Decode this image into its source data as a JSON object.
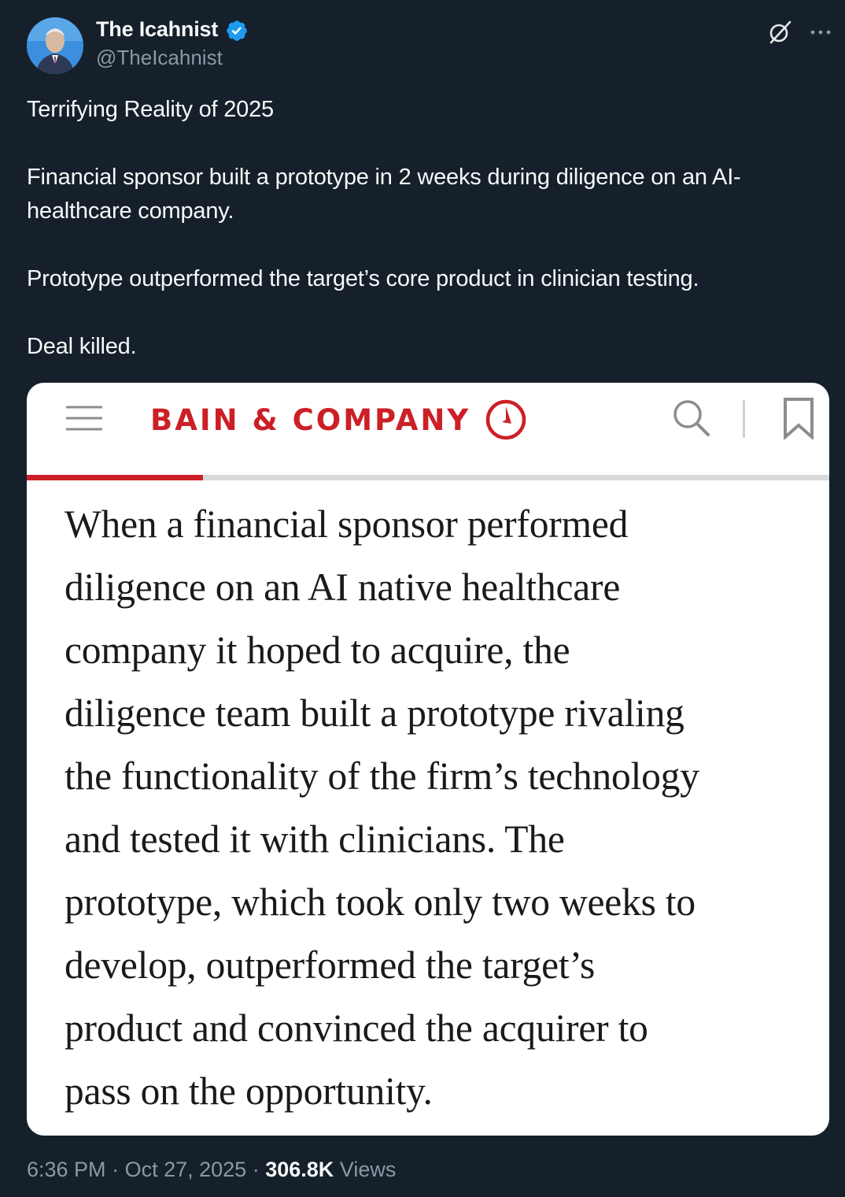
{
  "author": {
    "display_name": "The Icahnist",
    "handle": "@TheIcahnist",
    "verified": true,
    "avatar_icon": "avatar-photo"
  },
  "header_icons": [
    "grok-icon",
    "more-icon"
  ],
  "tweet": {
    "paragraphs": [
      "Terrifying Reality of 2025",
      "Financial sponsor built a prototype in 2 weeks during diligence on an AI-healthcare company.",
      "Prototype outperformed the target’s core product in clinician testing.",
      "Deal killed."
    ]
  },
  "card": {
    "brand": "BAIN & COMPANY",
    "brand_color": "#cc1f26",
    "reading_progress_percent": 22,
    "icons": [
      "menu-icon",
      "search-icon",
      "bookmark-icon"
    ],
    "article_lines": [
      "When a financial sponsor performed",
      "diligence on an AI native healthcare",
      "company it hoped to acquire, the",
      "diligence team built a prototype rivaling",
      "the functionality of the firm’s technology",
      "and tested it with clinicians. The",
      "prototype, which took only two weeks to",
      "develop, outperformed the target’s",
      "product and convinced the acquirer to",
      "pass on the opportunity."
    ]
  },
  "meta": {
    "time": "6:36 PM",
    "date": "Oct 27, 2025",
    "views_count": "306.8K",
    "views_label": "Views"
  },
  "colors": {
    "background": "#15202b",
    "text": "#f7f9f9",
    "secondary_text": "#8b98a5",
    "verified_blue": "#1d9bf0"
  }
}
